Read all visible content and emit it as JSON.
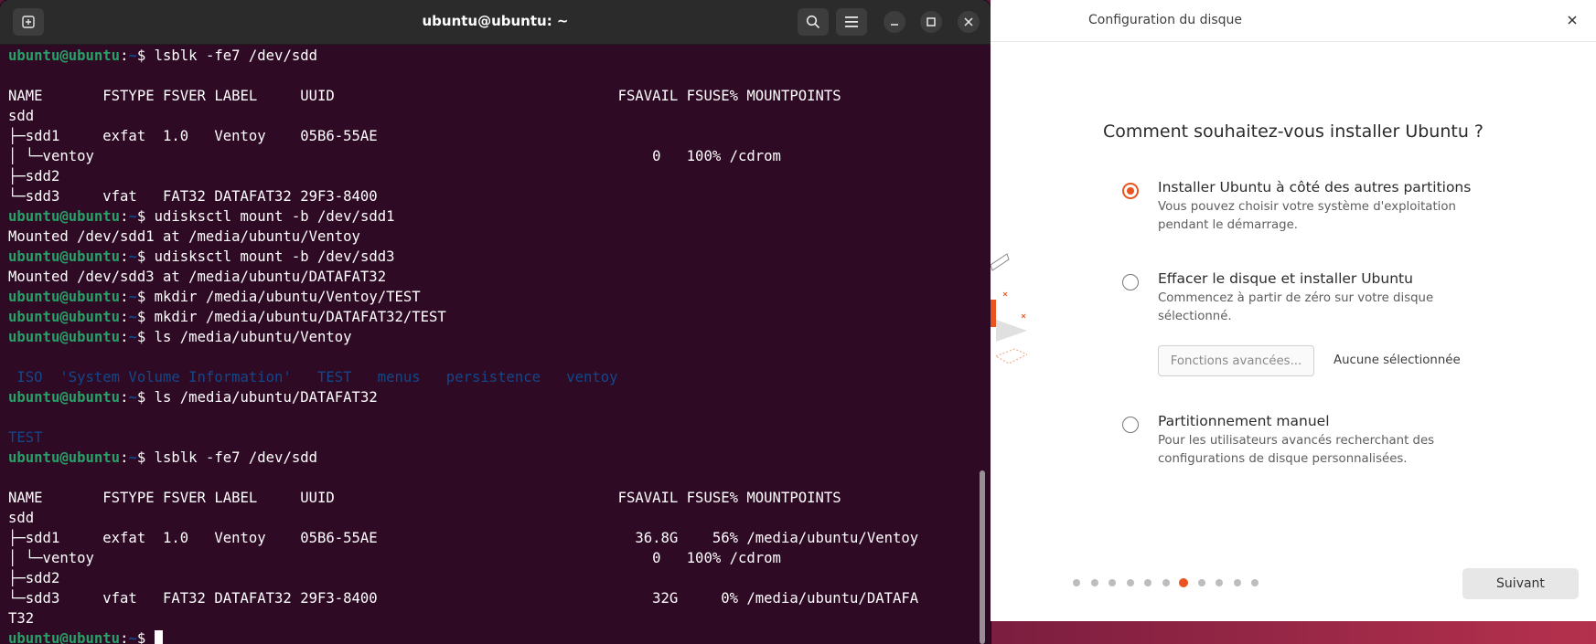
{
  "terminal": {
    "title": "ubuntu@ubuntu: ~",
    "prompt_user": "ubuntu@ubuntu",
    "prompt_sep": ":",
    "prompt_path": "~",
    "prompt_end": "$ ",
    "lines": [
      {
        "type": "prompt",
        "cmd": "lsblk -fe7 /dev/sdd"
      },
      {
        "type": "text",
        "text": ""
      },
      {
        "type": "text",
        "text": "NAME       FSTYPE FSVER LABEL     UUID                                 FSAVAIL FSUSE% MOUNTPOINTS"
      },
      {
        "type": "text",
        "text": "sdd"
      },
      {
        "type": "text",
        "text": "├─sdd1     exfat  1.0   Ventoy    05B6-55AE"
      },
      {
        "type": "text",
        "text": "│ └─ventoy                                                                 0   100% /cdrom"
      },
      {
        "type": "text",
        "text": "├─sdd2"
      },
      {
        "type": "text",
        "text": "└─sdd3     vfat   FAT32 DATAFAT32 29F3-8400"
      },
      {
        "type": "prompt",
        "cmd": "udisksctl mount -b /dev/sdd1"
      },
      {
        "type": "text",
        "text": "Mounted /dev/sdd1 at /media/ubuntu/Ventoy"
      },
      {
        "type": "prompt",
        "cmd": "udisksctl mount -b /dev/sdd3"
      },
      {
        "type": "text",
        "text": "Mounted /dev/sdd3 at /media/ubuntu/DATAFAT32"
      },
      {
        "type": "prompt",
        "cmd": "mkdir /media/ubuntu/Ventoy/TEST"
      },
      {
        "type": "prompt",
        "cmd": "mkdir /media/ubuntu/DATAFAT32/TEST"
      },
      {
        "type": "prompt",
        "cmd": "ls /media/ubuntu/Ventoy"
      },
      {
        "type": "text",
        "text": ""
      },
      {
        "type": "dir",
        "text": " ISO  'System Volume Information'   TEST   menus   persistence   ventoy"
      },
      {
        "type": "prompt",
        "cmd": "ls /media/ubuntu/DATAFAT32"
      },
      {
        "type": "text",
        "text": ""
      },
      {
        "type": "dir",
        "text": "TEST"
      },
      {
        "type": "prompt",
        "cmd": "lsblk -fe7 /dev/sdd"
      },
      {
        "type": "text",
        "text": ""
      },
      {
        "type": "text",
        "text": "NAME       FSTYPE FSVER LABEL     UUID                                 FSAVAIL FSUSE% MOUNTPOINTS"
      },
      {
        "type": "text",
        "text": "sdd"
      },
      {
        "type": "text",
        "text": "├─sdd1     exfat  1.0   Ventoy    05B6-55AE                              36.8G    56% /media/ubuntu/Ventoy"
      },
      {
        "type": "text",
        "text": "│ └─ventoy                                                                 0   100% /cdrom"
      },
      {
        "type": "text",
        "text": "├─sdd2"
      },
      {
        "type": "text",
        "text": "└─sdd3     vfat   FAT32 DATAFAT32 29F3-8400                                32G     0% /media/ubuntu/DATAFA"
      },
      {
        "type": "text",
        "text": "T32"
      },
      {
        "type": "prompt",
        "cmd": "",
        "cursor": true
      }
    ]
  },
  "installer": {
    "title": "Configuration du disque",
    "question": "Comment souhaitez-vous installer Ubuntu ?",
    "options": [
      {
        "title": "Installer Ubuntu à côté des autres partitions",
        "desc": "Vous pouvez choisir votre système d'exploitation pendant le démarrage.",
        "selected": true
      },
      {
        "title": "Effacer le disque et installer Ubuntu",
        "desc": "Commencez à partir de zéro sur votre disque sélectionné.",
        "selected": false
      },
      {
        "title": "Partitionnement manuel",
        "desc": "Pour les utilisateurs avancés recherchant des configurations de disque personnalisées.",
        "selected": false
      }
    ],
    "advanced_button": "Fonctions avancées...",
    "advanced_note": "Aucune sélectionnée",
    "next_button": "Suivant",
    "steps_total": 11,
    "steps_current": 7
  },
  "colors": {
    "accent": "#e95420",
    "prompt_user": "#26a269",
    "prompt_path": "#12488b",
    "terminal_bg": "#2f0a24"
  },
  "icons": {
    "new_tab": "new-tab-icon",
    "search": "search-icon",
    "menu": "hamburger-menu-icon",
    "minimize": "minimize-icon",
    "maximize": "maximize-icon",
    "close": "close-icon"
  }
}
